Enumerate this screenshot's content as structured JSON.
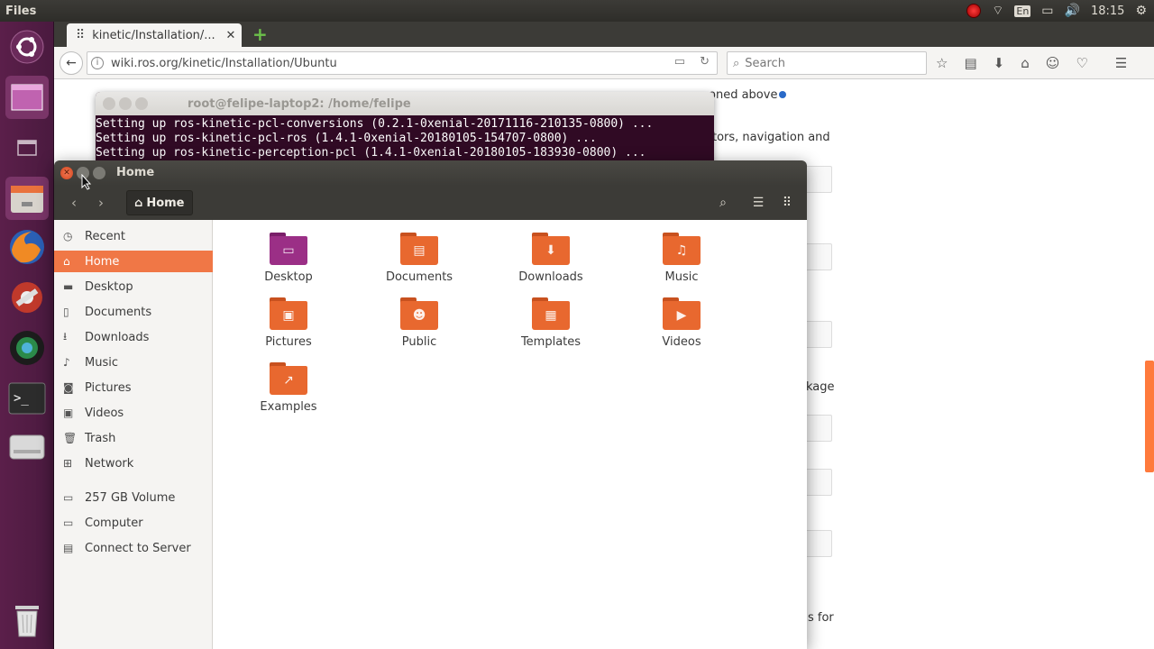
{
  "top_panel": {
    "app_title": "Files",
    "keyboard": "En",
    "clock": "18:15",
    "icons": [
      "record-icon",
      "wifi-icon",
      "keyboard-icon",
      "battery-icon",
      "volume-icon",
      "gear-icon"
    ]
  },
  "launcher": {
    "items": [
      "ubuntu-dash",
      "workspace-switcher",
      "window-spread",
      "files",
      "firefox",
      "system-settings",
      "shotwell",
      "terminal",
      "disk",
      "trash"
    ]
  },
  "browser": {
    "tab_title": "kinetic/Installation/...",
    "url": "wiki.ros.org/kinetic/Installation/Ubuntu",
    "search_placeholder": "Search",
    "page_fragments": {
      "f1": "oned above",
      "f2": "tors, navigation and",
      "f3": "kage",
      "f4": "s for"
    }
  },
  "terminal": {
    "title": "root@felipe-laptop2: /home/felipe",
    "lines": [
      "Setting up ros-kinetic-pcl-conversions (0.2.1-0xenial-20171116-210135-0800) ...",
      "Setting up ros-kinetic-pcl-ros (1.4.1-0xenial-20180105-154707-0800) ...",
      "Setting up ros-kinetic-perception-pcl (1.4.1-0xenial-20180105-183930-0800) ..."
    ]
  },
  "files": {
    "title": "Home",
    "path_label": "Home",
    "sidebar": [
      {
        "label": "Recent",
        "icon": "clock-icon"
      },
      {
        "label": "Home",
        "icon": "home-icon",
        "active": true
      },
      {
        "label": "Desktop",
        "icon": "folder-icon"
      },
      {
        "label": "Documents",
        "icon": "document-icon"
      },
      {
        "label": "Downloads",
        "icon": "download-icon"
      },
      {
        "label": "Music",
        "icon": "music-icon"
      },
      {
        "label": "Pictures",
        "icon": "camera-icon"
      },
      {
        "label": "Videos",
        "icon": "video-icon"
      },
      {
        "label": "Trash",
        "icon": "trash-icon"
      },
      {
        "label": "Network",
        "icon": "network-icon"
      },
      {
        "label": "257 GB Volume",
        "icon": "drive-icon"
      },
      {
        "label": "Computer",
        "icon": "computer-icon"
      },
      {
        "label": "Connect to Server",
        "icon": "server-icon"
      }
    ],
    "items": [
      {
        "label": "Desktop",
        "color": "#9b2f86",
        "glyph": "▭"
      },
      {
        "label": "Documents",
        "color": "#e8682f",
        "glyph": "▤"
      },
      {
        "label": "Downloads",
        "color": "#e8682f",
        "glyph": "⬇"
      },
      {
        "label": "Music",
        "color": "#e8682f",
        "glyph": "♫"
      },
      {
        "label": "Pictures",
        "color": "#e8682f",
        "glyph": "▣"
      },
      {
        "label": "Public",
        "color": "#e8682f",
        "glyph": "👤"
      },
      {
        "label": "Templates",
        "color": "#e8682f",
        "glyph": "▦"
      },
      {
        "label": "Videos",
        "color": "#e8682f",
        "glyph": "▶"
      },
      {
        "label": "Examples",
        "color": "#e8682f",
        "glyph": "↗"
      }
    ]
  },
  "colors": {
    "accent": "#f07746",
    "panel": "#3c3b37",
    "launcher": "#5b1f4a",
    "terminal_bg": "#300a24"
  }
}
